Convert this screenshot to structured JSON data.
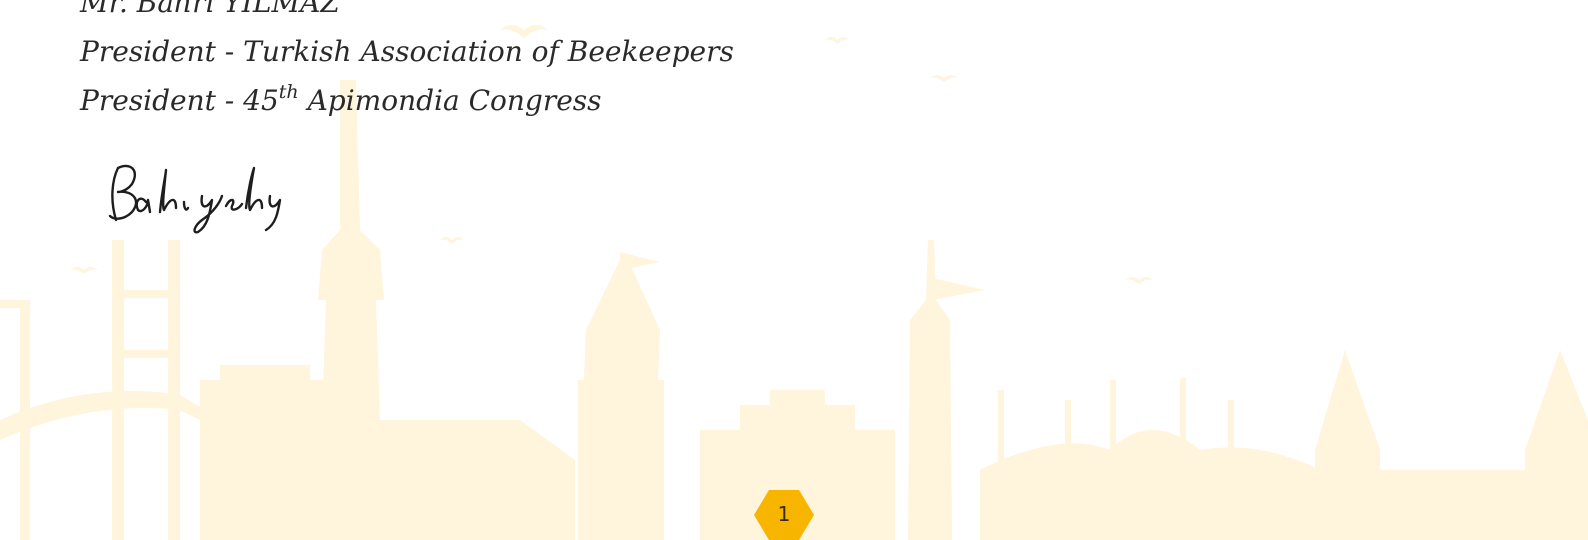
{
  "signatory": {
    "name": "Mr. Bahri YILMAZ",
    "title_line_1": "President - Turkish Association of Beekeepers",
    "title_line_2_prefix": "President - 45",
    "title_line_2_superscript": "th",
    "title_line_2_suffix": " Apimondia Congress",
    "signature_text": "Bahri yilmaz"
  },
  "page": {
    "number": "1"
  },
  "colors": {
    "skyline": "#fff4dc",
    "badge": "#f7b500",
    "text": "#2a2a2a"
  },
  "background": {
    "illustration": "istanbul-skyline-with-seagulls"
  }
}
